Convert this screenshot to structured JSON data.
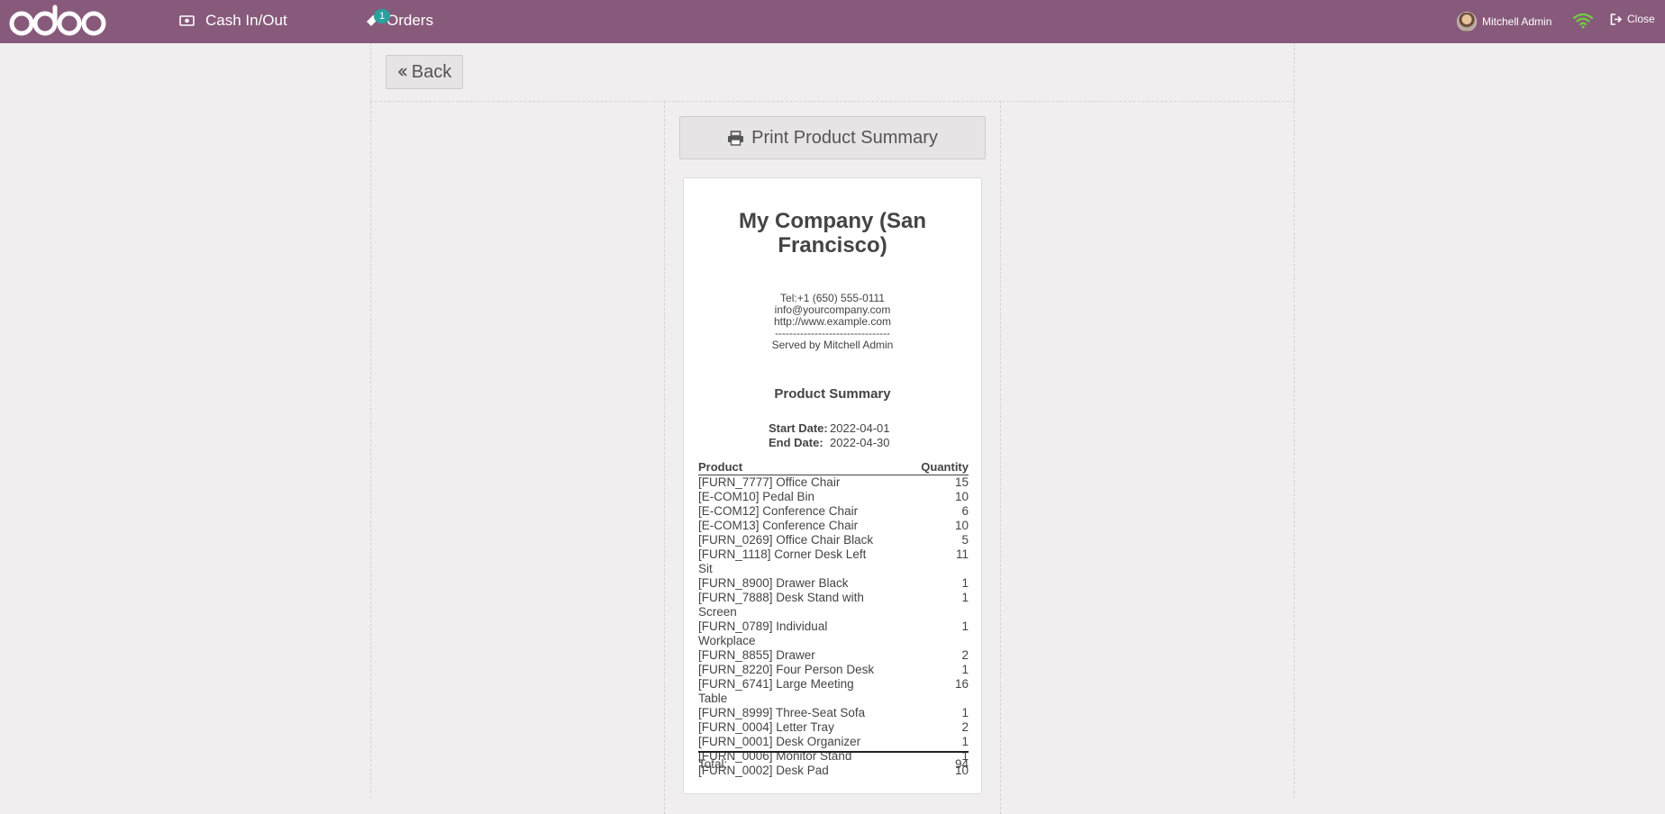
{
  "topbar": {
    "cash_label": "Cash In/Out",
    "orders_label": "Orders",
    "orders_badge": "1",
    "user_name": "Mitchell Admin",
    "close_label": "Close",
    "brand_color": "#875a7b"
  },
  "back_label": "Back",
  "print_label": "Print Product Summary",
  "receipt": {
    "company_line1": "My Company (San",
    "company_line2": "Francisco)",
    "tel": "Tel:+1 (650) 555-0111",
    "email": "info@yourcompany.com",
    "website": "http://www.example.com",
    "separator": "--------------------------------",
    "served_by": "Served by Mitchell Admin",
    "title": "Product Summary",
    "start_label": "Start Date:",
    "start_value": "2022-04-01",
    "end_label": "End Date:",
    "end_value": "2022-04-30",
    "col_product": "Product",
    "col_quantity": "Quantity",
    "rows": [
      {
        "name": "[FURN_7777] Office Chair",
        "qty": "15"
      },
      {
        "name": "[E-COM10] Pedal Bin",
        "qty": "10"
      },
      {
        "name": "[E-COM12] Conference Chair",
        "qty": "6"
      },
      {
        "name": "[E-COM13] Conference Chair",
        "qty": "10"
      },
      {
        "name": "[FURN_0269] Office Chair Black",
        "qty": "5"
      },
      {
        "name": "[FURN_1118] Corner Desk Left Sit",
        "qty": "11"
      },
      {
        "name": "[FURN_8900] Drawer Black",
        "qty": "1"
      },
      {
        "name": "[FURN_7888] Desk Stand with Screen",
        "qty": "1"
      },
      {
        "name": "[FURN_0789] Individual Workplace",
        "qty": "1"
      },
      {
        "name": "[FURN_8855] Drawer",
        "qty": "2"
      },
      {
        "name": "[FURN_8220] Four Person Desk",
        "qty": "1"
      },
      {
        "name": "[FURN_6741] Large Meeting Table",
        "qty": "16"
      },
      {
        "name": "[FURN_8999] Three-Seat Sofa",
        "qty": "1"
      },
      {
        "name": "[FURN_0004] Letter Tray",
        "qty": "2"
      },
      {
        "name": "[FURN_0001] Desk Organizer",
        "qty": "1"
      },
      {
        "name": "[FURN_0006] Monitor Stand",
        "qty": "1"
      },
      {
        "name": "[FURN_0002] Desk Pad",
        "qty": "10"
      }
    ],
    "total_label": "Total:",
    "total_value": "94"
  }
}
